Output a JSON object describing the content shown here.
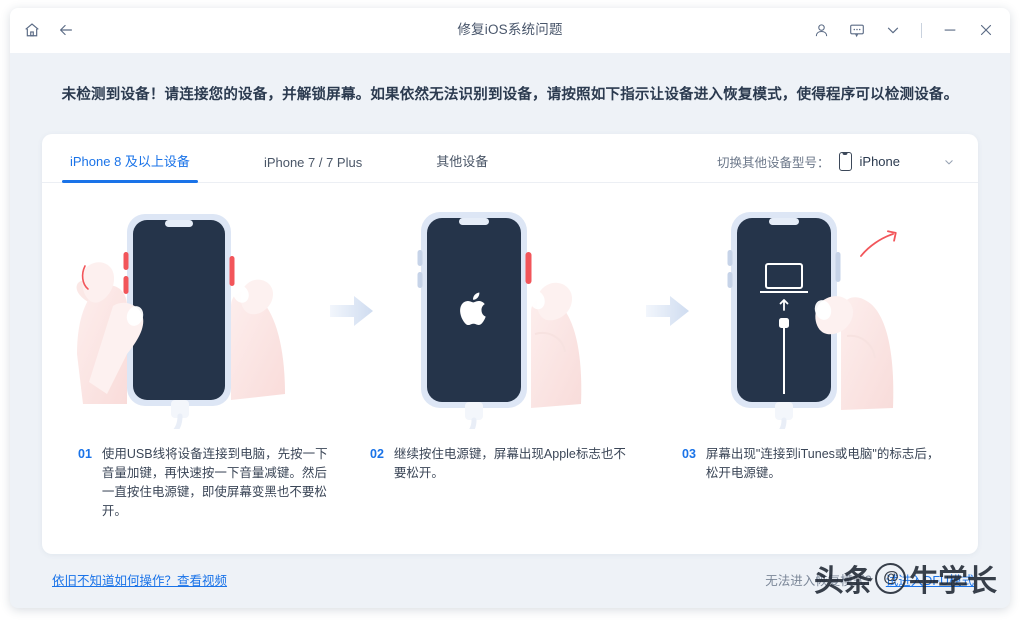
{
  "window": {
    "title": "修复iOS系统问题",
    "home_icon": "home-icon",
    "back_icon": "back-arrow-icon",
    "account_icon": "user-icon",
    "feedback_icon": "message-icon",
    "menu_icon": "chevron-down-icon",
    "minimize_icon": "minimize-icon",
    "close_icon": "close-icon"
  },
  "headline": "未检测到设备！请连接您的设备，并解锁屏幕。如果依然无法识别到设备，请按照如下指示让设备进入恢复模式，使得程序可以检测设备。",
  "tabs": [
    {
      "label": "iPhone 8 及以上设备",
      "active": true
    },
    {
      "label": "iPhone 7 / 7 Plus",
      "active": false
    },
    {
      "label": "其他设备",
      "active": false
    }
  ],
  "device_switch": {
    "label": "切换其他设备型号：",
    "value": "iPhone",
    "icon": "phone-icon",
    "chevron": "chevron-down-icon"
  },
  "steps": [
    {
      "number": "01",
      "text": "使用USB线将设备连接到电脑，先按一下音量加键，再快速按一下音量减键。然后一直按住电源键，即使屏幕变黑也不要松开。"
    },
    {
      "number": "02",
      "text": "继续按住电源键，屏幕出现Apple标志也不要松开。"
    },
    {
      "number": "03",
      "text": "屏幕出现\"连接到iTunes或电脑\"的标志后，松开电源键。"
    }
  ],
  "footer": {
    "left_link": "依旧不知道如何操作？查看视频",
    "right_text": "无法进入恢复模式？",
    "right_link": "试进入DFU模式"
  },
  "watermark": {
    "prefix": "头条",
    "at": "@",
    "suffix": "牛学长"
  },
  "colors": {
    "accent": "#1a73e8",
    "page_bg": "#eef2f7",
    "card_bg": "#ffffff",
    "text_dark": "#2b3a4f",
    "text_muted": "#7b8798",
    "phone_body": "#d9e2f2",
    "phone_screen": "#25344a",
    "button_highlight": "#f2555a"
  }
}
